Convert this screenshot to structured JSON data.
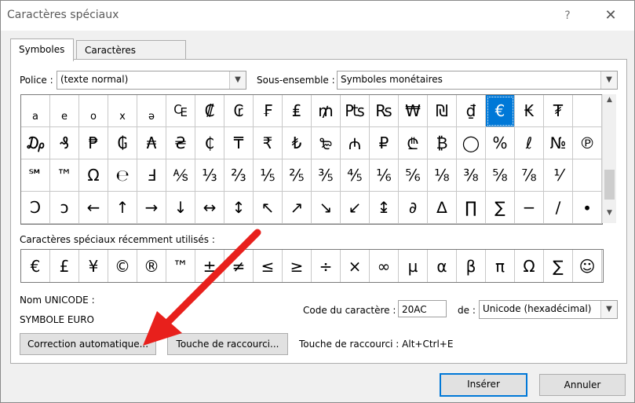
{
  "window": {
    "title": "Caractères spéciaux",
    "help": "?",
    "close": "✕"
  },
  "tabs": [
    {
      "label": "Symboles",
      "active": true
    },
    {
      "label": "Caractères spéciaux",
      "active": false
    }
  ],
  "font": {
    "label": "Police :",
    "value": "(texte normal)"
  },
  "subset": {
    "label": "Sous-ensemble :",
    "value": "Symboles monétaires"
  },
  "symbol_grid": [
    [
      "a",
      "e",
      "o",
      "x",
      "ə",
      "₠",
      "₡",
      "₢",
      "₣",
      "₤",
      "₥",
      "₧",
      "₨",
      "₩",
      "₪",
      "₫",
      "€",
      "₭",
      "₮",
      ""
    ],
    [
      "₯",
      "₰",
      "₱",
      "₲",
      "₳",
      "₴",
      "₵",
      "₸",
      "₹",
      "₺",
      "₻",
      "₼",
      "₽",
      "₾",
      "₿",
      "◯",
      "%",
      "ℓ",
      "№",
      "℗"
    ],
    [
      "℠",
      "™",
      "Ω",
      "℮",
      "Ⅎ",
      "⅍",
      "⅓",
      "⅔",
      "⅕",
      "⅖",
      "⅗",
      "⅘",
      "⅙",
      "⅚",
      "⅛",
      "⅜",
      "⅝",
      "⅞",
      "⅟",
      ""
    ],
    [
      "Ↄ",
      "ↄ",
      "←",
      "↑",
      "→",
      "↓",
      "↔",
      "↕",
      "↖",
      "↗",
      "↘",
      "↙",
      "↨",
      "∂",
      "∆",
      "∏",
      "∑",
      "−",
      "∕",
      "∙"
    ]
  ],
  "selected_cell": {
    "row": 0,
    "col": 16
  },
  "recent": {
    "label": "Caractères spéciaux récemment utilisés :",
    "symbols": [
      "€",
      "£",
      "¥",
      "©",
      "®",
      "™",
      "±",
      "≠",
      "≤",
      "≥",
      "÷",
      "×",
      "∞",
      "µ",
      "α",
      "β",
      "π",
      "Ω",
      "∑",
      "☺"
    ]
  },
  "unicode_name": {
    "label": "Nom UNICODE :",
    "value": "SYMBOLE EURO"
  },
  "char_code": {
    "label": "Code du caractère :",
    "value": "20AC"
  },
  "from": {
    "label": "de :",
    "value": "Unicode (hexadécimal)"
  },
  "buttons": {
    "autocorrect": "Correction automatique...",
    "shortcut_key": "Touche de raccourci...",
    "insert": "Insérer",
    "cancel": "Annuler"
  },
  "shortcut_info": "Touche de raccourci : Alt+Ctrl+E",
  "annotation": {
    "arrow_color": "#e8201c"
  },
  "colors": {
    "selection": "#0078d7"
  }
}
